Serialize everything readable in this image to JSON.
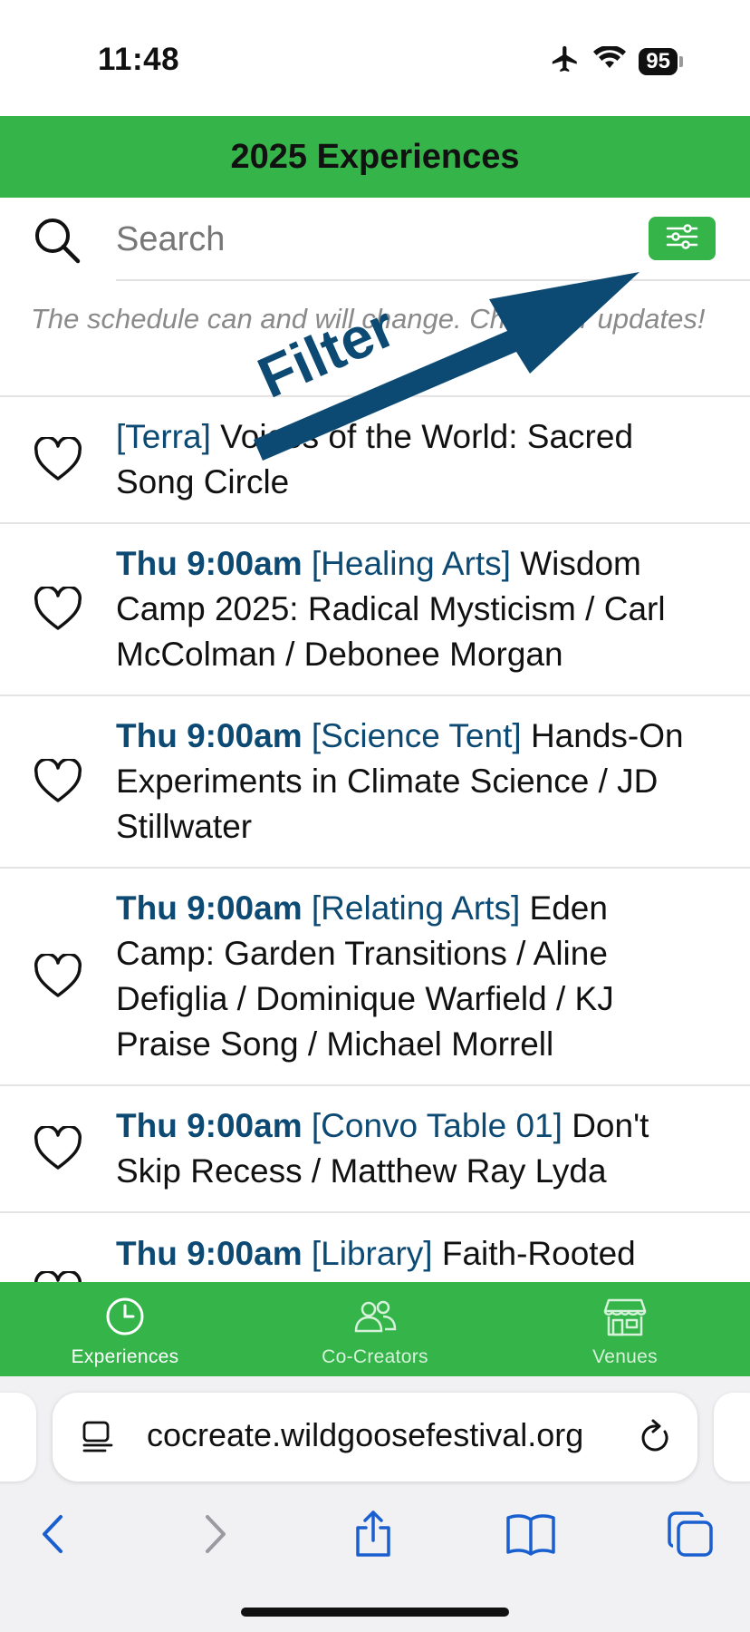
{
  "status_bar": {
    "time": "11:48",
    "battery": "95"
  },
  "header": {
    "title": "2025 Experiences"
  },
  "search": {
    "placeholder": "Search"
  },
  "notice": "The schedule can and will change. Check for updates!",
  "annotation": {
    "text": "Filter",
    "color": "#0c4a74"
  },
  "experiences": [
    {
      "time": "",
      "venue": "[Terra]",
      "title": "Voices of the World: Sacred Song Circle"
    },
    {
      "time": "Thu 9:00am",
      "venue": "[Healing Arts]",
      "title": "Wisdom Camp 2025: Radical Mysticism / Carl McColman / Debonee Morgan"
    },
    {
      "time": "Thu 9:00am",
      "venue": "[Science Tent]",
      "title": "Hands-On Experiments in Climate Science / JD Stillwater"
    },
    {
      "time": "Thu 9:00am",
      "venue": "[Relating Arts]",
      "title": "Eden Camp: Garden Transitions / Aline Defiglia / Dominique Warfield / KJ Praise Song / Michael Morrell"
    },
    {
      "time": "Thu 9:00am",
      "venue": "[Convo Table 01]",
      "title": "Don't Skip Recess / Matthew Ray Lyda"
    },
    {
      "time": "Thu 9:00am",
      "venue": "[Library]",
      "title": "Faith-Rooted"
    }
  ],
  "tabs": [
    {
      "label": "Experiences",
      "icon": "clock-icon",
      "active": true
    },
    {
      "label": "Co-Creators",
      "icon": "people-icon",
      "active": false
    },
    {
      "label": "Venues",
      "icon": "storefront-icon",
      "active": false
    }
  ],
  "browser": {
    "url": "cocreate.wildgoosefestival.org"
  },
  "colors": {
    "brand_green": "#34b449",
    "accent_blue": "#0c4a74",
    "ios_blue": "#1a5fd0"
  }
}
